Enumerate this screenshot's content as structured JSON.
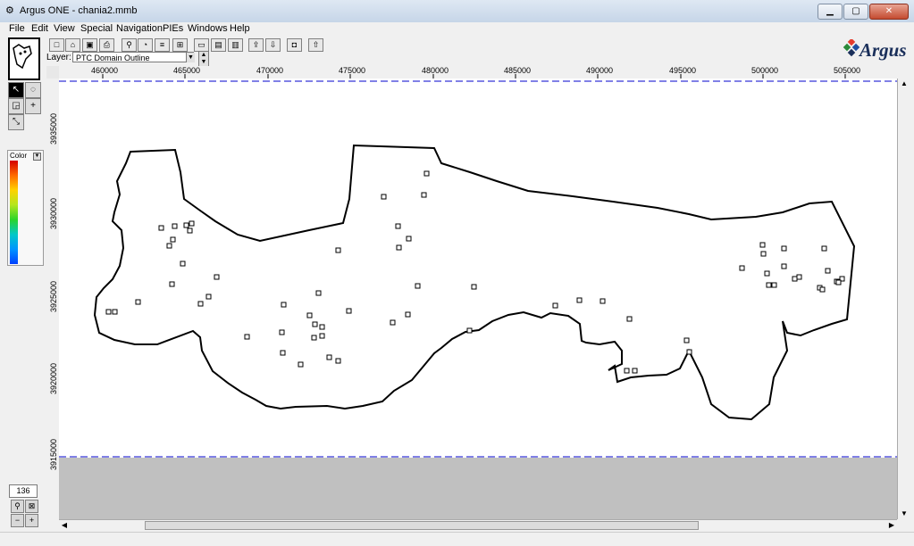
{
  "window": {
    "title": "Argus ONE - chania2.mmb",
    "buttons": [
      "minimize",
      "maximize",
      "close"
    ]
  },
  "menu": [
    "File",
    "Edit",
    "View",
    "Special",
    "Navigation",
    "PIEs",
    "Windows",
    "Help"
  ],
  "toolbar": {
    "icons": [
      "new-icon",
      "open-icon",
      "save-icon",
      "print-icon",
      "find-icon",
      "pie-icon",
      "layers-icon",
      "grid-icon",
      "frame-icon",
      "window-icon",
      "chart-icon",
      "export-icon",
      "import-icon",
      "camera-icon",
      "import-layer-icon"
    ],
    "layer_label": "Layer:",
    "layer_value": "PTC Domain Outline"
  },
  "logo": {
    "text": "Argus"
  },
  "palette": {
    "tools": [
      "select-icon",
      "lasso-icon",
      "zoom-box-icon",
      "add-point-icon",
      "scale-icon"
    ]
  },
  "color_legend": {
    "label": "Color",
    "colors": [
      "#d40000",
      "#ff6a00",
      "#ffd200",
      "#b5e61d",
      "#2bd42b",
      "#00c8c8",
      "#0094ff",
      "#0040ff"
    ]
  },
  "zoom": {
    "value": "136"
  },
  "ruler": {
    "x_ticks": [
      "460000",
      "465000",
      "470000",
      "475000",
      "480000",
      "485000",
      "490000",
      "495000",
      "500000",
      "505000"
    ],
    "y_ticks": [
      "3935000",
      "3930000",
      "3925000",
      "3920000",
      "3915000"
    ]
  },
  "colors": {
    "outline": "#000000",
    "canvas": "#ffffff",
    "outside": "#c0c0c0",
    "boundary_line": "#0000cc"
  }
}
